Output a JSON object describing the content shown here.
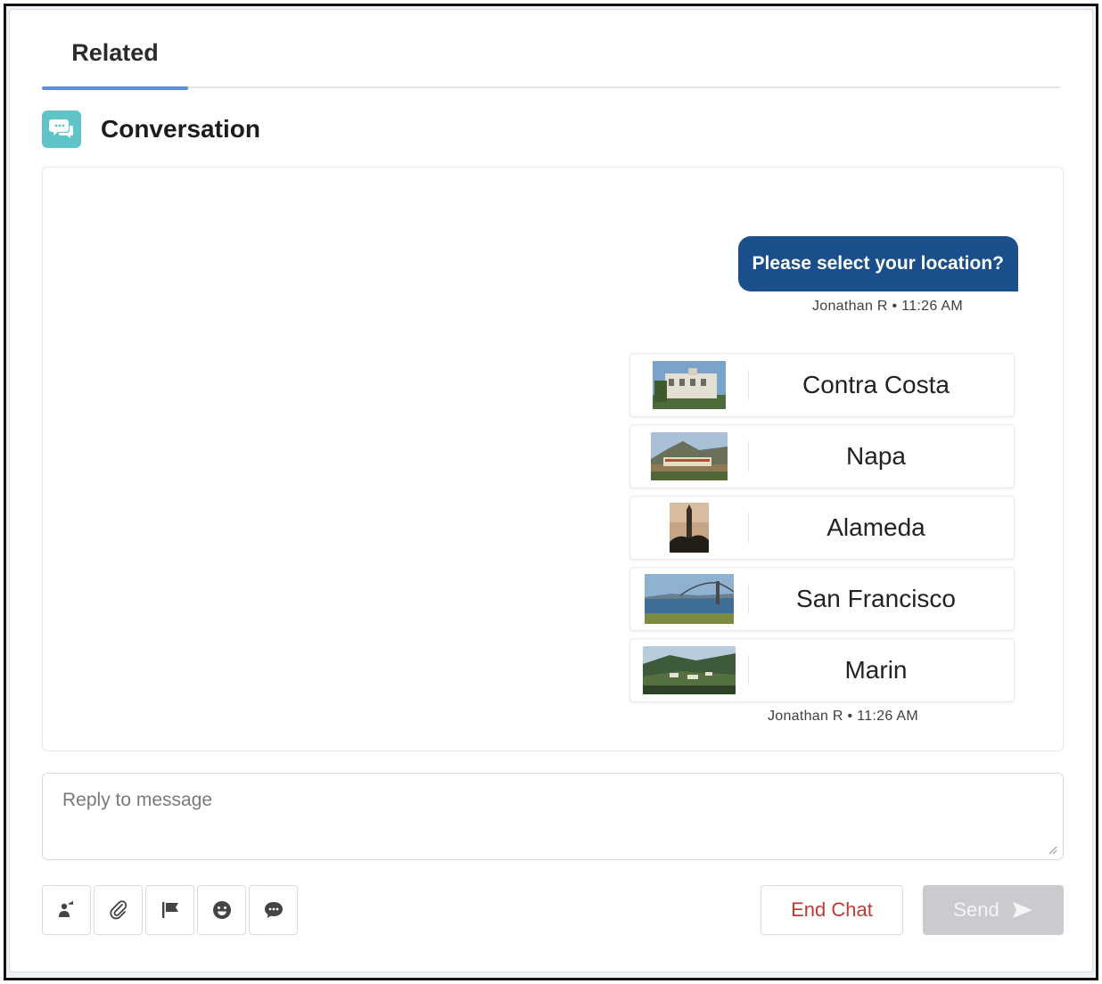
{
  "tabs": [
    {
      "label": "Related",
      "active": true
    }
  ],
  "section": {
    "title": "Conversation",
    "icon": "chat-bubbles-icon"
  },
  "messages": [
    {
      "text": "Please select your location?",
      "meta": "Jonathan R • 11:26 AM"
    }
  ],
  "location_options": {
    "items": [
      {
        "label": "Contra Costa",
        "image": "contra-costa-building-photo"
      },
      {
        "label": "Napa",
        "image": "napa-hills-photo"
      },
      {
        "label": "Alameda",
        "image": "alameda-tower-photo"
      },
      {
        "label": "San Francisco",
        "image": "san-francisco-bay-bridge-photo"
      },
      {
        "label": "Marin",
        "image": "marin-hills-photo"
      }
    ],
    "meta": "Jonathan R • 11:26 AM"
  },
  "reply": {
    "placeholder": "Reply to message"
  },
  "toolbar": {
    "tools": [
      "transfer-icon",
      "attachment-icon",
      "flag-icon",
      "emoji-icon",
      "quick-text-icon"
    ],
    "end_chat_label": "End Chat",
    "send_label": "Send"
  },
  "colors": {
    "accent_tab": "#5a8fd8",
    "bubble": "#1b4f8c",
    "conversation_icon": "#5ec4c8",
    "end_chat_text": "#c23934",
    "send_disabled": "#c9cbcf"
  }
}
